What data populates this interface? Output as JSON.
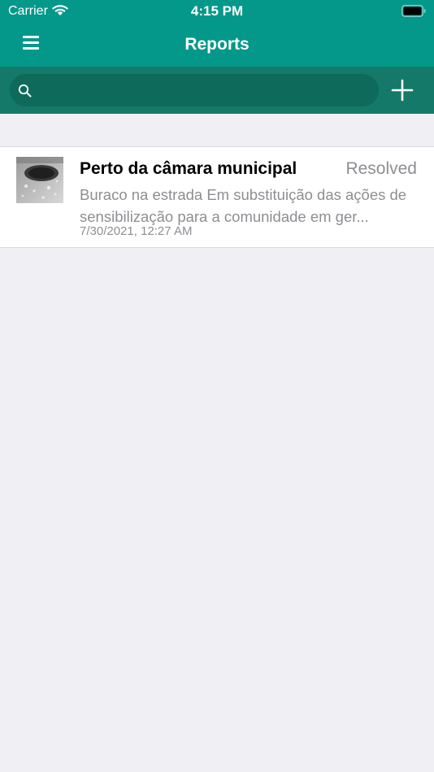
{
  "status_bar": {
    "carrier": "Carrier",
    "time": "4:15 PM",
    "icons": [
      "wifi-icon",
      "battery-icon"
    ]
  },
  "nav": {
    "title": "Reports",
    "left_icon": "hamburger-menu-icon",
    "right_icon": "add-icon"
  },
  "search": {
    "placeholder": "",
    "value": "",
    "icon": "search-icon"
  },
  "reports": [
    {
      "title": "Perto da câmara municipal",
      "status": "Resolved",
      "description": "Buraco na estrada Em substituição das ações de sensibilização para a comunidade em ger...",
      "date": "7/30/2021, 12:27 AM",
      "thumbnail": "pothole-photo"
    }
  ],
  "colors": {
    "header": "#03988a",
    "search_band": "#147968",
    "search_field": "#0e6a5b",
    "background": "#efeff4",
    "secondary_text": "#8e8e93"
  }
}
